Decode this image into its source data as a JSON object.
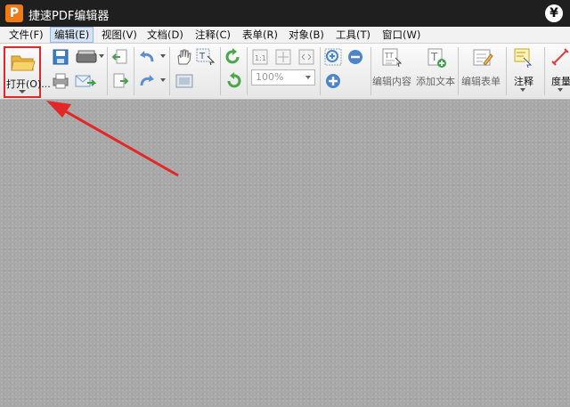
{
  "window": {
    "logo_letter": "P",
    "title": "捷速PDF编辑器",
    "currency_glyph": "¥"
  },
  "menu": [
    {
      "label": "文件(F)",
      "active": false
    },
    {
      "label": "编辑(E)",
      "active": true
    },
    {
      "label": "视图(V)",
      "active": false
    },
    {
      "label": "文档(D)",
      "active": false
    },
    {
      "label": "注释(C)",
      "active": false
    },
    {
      "label": "表单(R)",
      "active": false
    },
    {
      "label": "对象(B)",
      "active": false
    },
    {
      "label": "工具(T)",
      "active": false
    },
    {
      "label": "窗口(W)",
      "active": false
    }
  ],
  "toolbar": {
    "open_label": "打开(O)...",
    "zoom_value": "100%",
    "edit_content_label": "编辑内容",
    "add_text_label": "添加文本",
    "edit_form_label": "编辑表单",
    "annotate_label": "注释",
    "measure_label": "度量"
  },
  "icons": {
    "open": "folder-open-icon",
    "save": "save-icon",
    "print": "printer-icon",
    "scan": "scanner-icon",
    "email": "email-icon",
    "prev_page": "page-back-icon",
    "next_page": "page-forward-icon",
    "undo": "undo-icon",
    "redo": "redo-icon",
    "hand": "hand-tool-icon",
    "select_text": "select-text-icon",
    "snapshot": "snapshot-icon",
    "rotate_cw": "rotate-clockwise-icon",
    "rotate_ccw": "rotate-counterclockwise-icon",
    "actual_size": "actual-size-icon",
    "fit_page": "fit-page-icon",
    "fit_width": "fit-width-icon",
    "zoom_in": "zoom-in-icon",
    "zoom_out": "zoom-out-icon",
    "zoom_plus": "zoom-plus-icon"
  },
  "colors": {
    "title_bar": "#1f1f1f",
    "logo": "#f07a14",
    "highlight_box": "#e32626",
    "arrow": "#e32626",
    "doc_background": "#a8a8a8"
  }
}
